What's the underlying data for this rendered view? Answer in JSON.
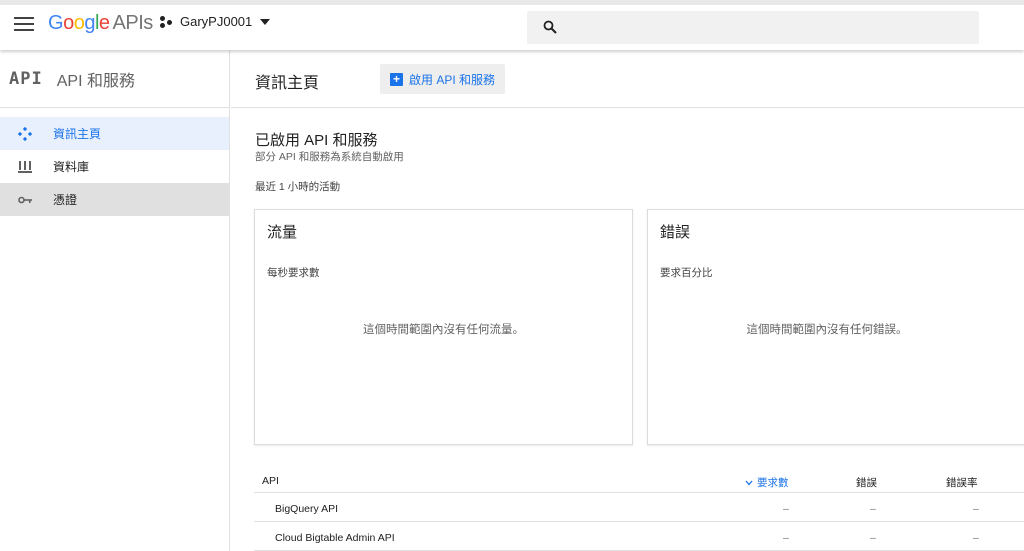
{
  "topbar": {
    "logo_google": [
      "G",
      "o",
      "o",
      "g",
      "l",
      "e"
    ],
    "logo_apis": "APIs",
    "project_name": "GaryPJ0001",
    "search_placeholder": ""
  },
  "sidebar": {
    "logo_text": "API",
    "title": "API 和服務",
    "items": [
      {
        "label": "資訊主頁",
        "icon": "dashboard-icon",
        "active": true
      },
      {
        "label": "資料庫",
        "icon": "library-icon",
        "active": false
      },
      {
        "label": "憑證",
        "icon": "key-icon",
        "active": false
      }
    ]
  },
  "main": {
    "page_title": "資訊主頁",
    "enable_button_label": "啟用 API 和服務",
    "section_title": "已啟用 API 和服務",
    "section_subtitle": "部分 API 和服務為系統自動啟用",
    "activity_label": "最近 1 小時的活動",
    "traffic_card": {
      "title": "流量",
      "metric": "每秒要求數",
      "empty": "這個時間範圍內沒有任何流量。"
    },
    "errors_card": {
      "title": "錯誤",
      "metric": "要求百分比",
      "empty": "這個時間範圍內沒有任何錯誤。"
    },
    "table": {
      "headers": {
        "api": "API",
        "requests": "要求數",
        "errors": "錯誤",
        "error_rate": "錯誤率"
      },
      "rows": [
        {
          "name": "BigQuery API",
          "requests": "–",
          "errors": "–",
          "error_rate": "–"
        },
        {
          "name": "Cloud Bigtable Admin API",
          "requests": "–",
          "errors": "–",
          "error_rate": "–"
        }
      ]
    }
  },
  "colors": {
    "accent": "#1a73e8",
    "active_bg": "#e8f0fe"
  }
}
